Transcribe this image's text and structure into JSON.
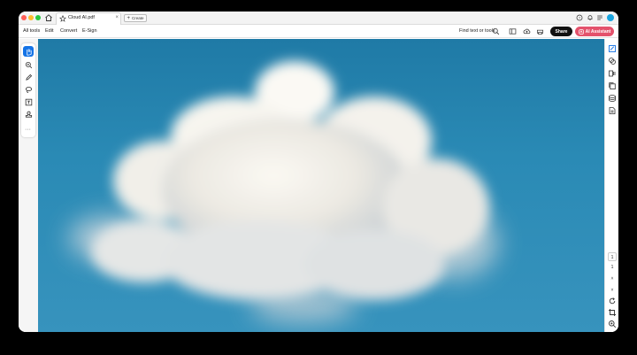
{
  "tab": {
    "title": "Cloud AI.pdf",
    "close": "×"
  },
  "create": {
    "label": "Create",
    "icon": "plus-icon"
  },
  "menu": {
    "all_tools": "All tools",
    "edit": "Edit",
    "convert": "Convert",
    "esign": "E-Sign"
  },
  "find": {
    "label": "Find text or tools"
  },
  "share": {
    "label": "Share"
  },
  "ai_assistant": {
    "label": "AI Assistant"
  },
  "left_tools": [
    "hand-icon",
    "zoom-tool-icon",
    "pen-icon",
    "lasso-icon",
    "text-box-icon",
    "stamp-icon"
  ],
  "right_tools": [
    "comment-icon",
    "layers-icon",
    "pages-icon",
    "copy-icon",
    "stack-icon",
    "document-icon"
  ],
  "pagination": {
    "current": "1",
    "total": "1",
    "up": "˄",
    "down": "˅"
  },
  "colors": {
    "accent": "#1473e6",
    "ai_button": "#e4526c",
    "share_button": "#111111",
    "sky": "#2a8ab5"
  }
}
